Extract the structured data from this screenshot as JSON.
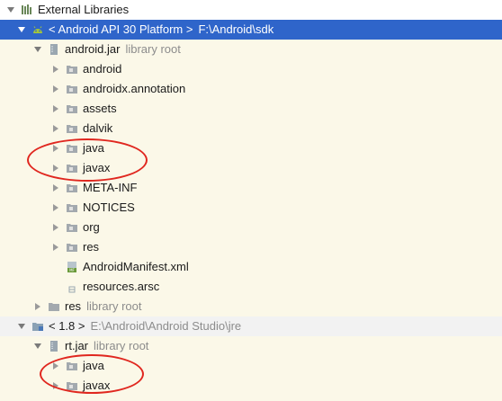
{
  "tree": {
    "root_label": "External Libraries",
    "sdk": {
      "label": "< Android API 30 Platform >",
      "path": "F:\\Android\\sdk"
    },
    "android_jar": {
      "label": "android.jar",
      "hint": "library root"
    },
    "android_jar_children": [
      "android",
      "androidx.annotation",
      "assets",
      "dalvik",
      "java",
      "javax",
      "META-INF",
      "NOTICES",
      "org",
      "res"
    ],
    "manifest_file": "AndroidManifest.xml",
    "resources_file": "resources.arsc",
    "res_lib": {
      "label": "res",
      "hint": "library root"
    },
    "jdk": {
      "label": "< 1.8 >",
      "path": "E:\\Android\\Android Studio\\jre"
    },
    "rt_jar": {
      "label": "rt.jar",
      "hint": "library root"
    },
    "rt_jar_children": [
      "java",
      "javax"
    ]
  },
  "colors": {
    "selection": "#2f65ca",
    "highlight_circle": "#e0271f",
    "background": "#fbf8e8"
  }
}
